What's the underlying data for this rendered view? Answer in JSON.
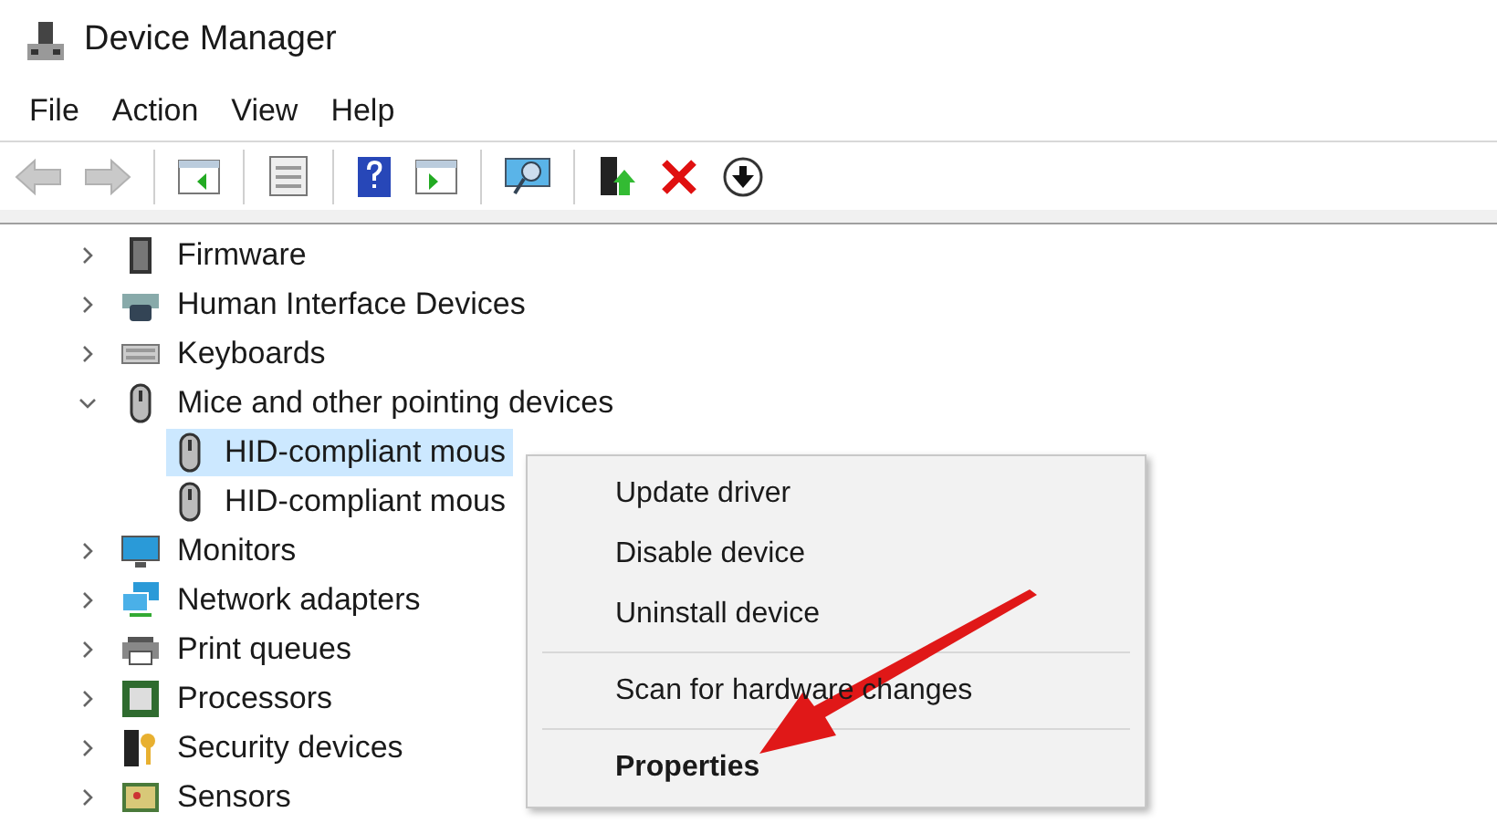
{
  "window": {
    "title": "Device Manager"
  },
  "menu_bar": [
    "File",
    "Action",
    "View",
    "Help"
  ],
  "toolbar": [
    {
      "kind": "back",
      "disabled": true
    },
    {
      "kind": "forward",
      "disabled": true
    },
    {
      "kind": "sep"
    },
    {
      "kind": "tree",
      "disabled": false
    },
    {
      "kind": "sep"
    },
    {
      "kind": "properties",
      "disabled": false
    },
    {
      "kind": "sep"
    },
    {
      "kind": "help",
      "disabled": false
    },
    {
      "kind": "pane",
      "disabled": false
    },
    {
      "kind": "sep"
    },
    {
      "kind": "scan",
      "disabled": false
    },
    {
      "kind": "sep"
    },
    {
      "kind": "update",
      "disabled": false
    },
    {
      "kind": "uninstall",
      "disabled": false
    },
    {
      "kind": "disable",
      "disabled": false
    }
  ],
  "tree": [
    {
      "label": "Firmware",
      "kind": "chip",
      "expanded": false
    },
    {
      "label": "Human Interface Devices",
      "kind": "hid",
      "expanded": false
    },
    {
      "label": "Keyboards",
      "kind": "keyboard",
      "expanded": false
    },
    {
      "label": "Mice and other pointing devices",
      "kind": "mouse",
      "expanded": true,
      "children": [
        {
          "label": "HID-compliant mous",
          "kind": "mouse",
          "selected": true
        },
        {
          "label": "HID-compliant mous",
          "kind": "mouse",
          "selected": false
        }
      ]
    },
    {
      "label": "Monitors",
      "kind": "monitor",
      "expanded": false
    },
    {
      "label": "Network adapters",
      "kind": "network",
      "expanded": false
    },
    {
      "label": "Print queues",
      "kind": "printer",
      "expanded": false
    },
    {
      "label": "Processors",
      "kind": "cpu",
      "expanded": false
    },
    {
      "label": "Security devices",
      "kind": "security",
      "expanded": false
    },
    {
      "label": "Sensors",
      "kind": "sensor",
      "expanded": false
    }
  ],
  "context_menu": [
    {
      "kind": "item",
      "label": "Update driver",
      "bold": false
    },
    {
      "kind": "item",
      "label": "Disable device",
      "bold": false
    },
    {
      "kind": "item",
      "label": "Uninstall device",
      "bold": false
    },
    {
      "kind": "separator"
    },
    {
      "kind": "item",
      "label": "Scan for hardware changes",
      "bold": false
    },
    {
      "kind": "separator"
    },
    {
      "kind": "item",
      "label": "Properties",
      "bold": true
    }
  ]
}
